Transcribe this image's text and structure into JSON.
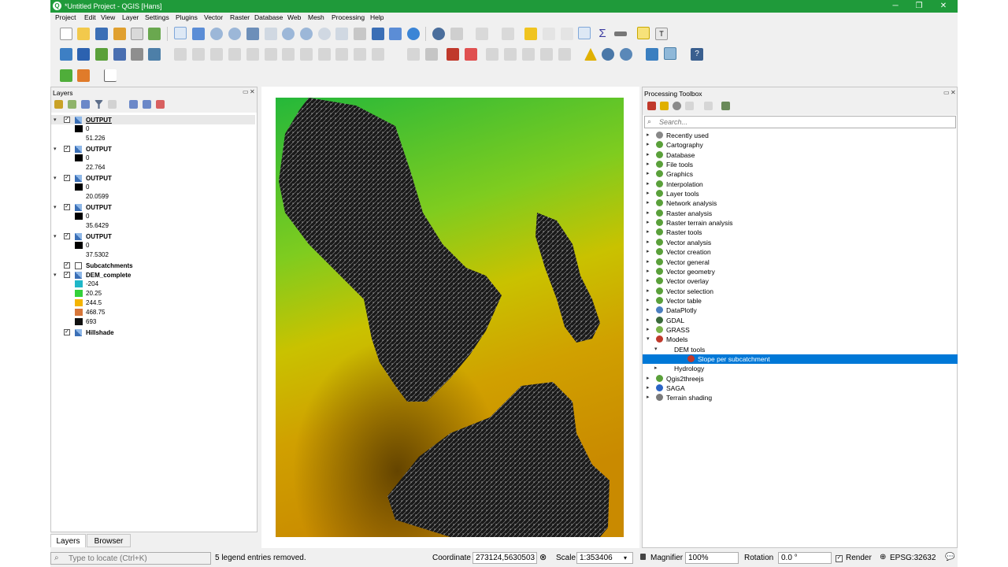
{
  "window": {
    "title": "*Untitled Project - QGIS [Hans]",
    "logo_text": "Q",
    "controls": [
      "─",
      "❐",
      "✕"
    ]
  },
  "menu": [
    "Project",
    "Edit",
    "View",
    "Layer",
    "Settings",
    "Plugins",
    "Vector",
    "Raster",
    "Database",
    "Web",
    "Mesh",
    "Processing",
    "Help"
  ],
  "layers_panel": {
    "title": "Layers",
    "layers": [
      {
        "name": "OUTPUT",
        "checked": true,
        "active": true,
        "legend": [
          {
            "label": "0",
            "color": "#000000"
          }
        ],
        "max_label": "51.226"
      },
      {
        "name": "OUTPUT",
        "checked": true,
        "legend": [
          {
            "label": "0",
            "color": "#000000"
          }
        ],
        "max_label": "22.764"
      },
      {
        "name": "OUTPUT",
        "checked": true,
        "legend": [
          {
            "label": "0",
            "color": "#000000"
          }
        ],
        "max_label": "20.0599"
      },
      {
        "name": "OUTPUT",
        "checked": true,
        "legend": [
          {
            "label": "0",
            "color": "#000000"
          }
        ],
        "max_label": "35.6429"
      },
      {
        "name": "OUTPUT",
        "checked": true,
        "legend": [
          {
            "label": "0",
            "color": "#000000"
          }
        ],
        "max_label": "37.5302"
      }
    ],
    "subcatchments": {
      "name": "Subcatchments",
      "checked": true
    },
    "dem": {
      "name": "DEM_complete",
      "checked": true,
      "legend": [
        {
          "label": "-204",
          "color": "#1fb7c8"
        },
        {
          "label": "20.25",
          "color": "#34d13a"
        },
        {
          "label": "244.5",
          "color": "#f4b400"
        },
        {
          "label": "468.75",
          "color": "#d7773a"
        },
        {
          "label": "693",
          "color": "#111111"
        }
      ]
    },
    "hillshade": {
      "name": "Hillshade",
      "checked": true
    }
  },
  "toolbox": {
    "title": "Processing Toolbox",
    "search_placeholder": "Search...",
    "items": [
      {
        "label": "Recently used",
        "icon": "clock-icon",
        "color": "#888888"
      },
      {
        "label": "Cartography",
        "icon": "qgis-icon",
        "color": "#5aa03a"
      },
      {
        "label": "Database",
        "icon": "qgis-icon",
        "color": "#5aa03a"
      },
      {
        "label": "File tools",
        "icon": "qgis-icon",
        "color": "#5aa03a"
      },
      {
        "label": "Graphics",
        "icon": "qgis-icon",
        "color": "#5aa03a"
      },
      {
        "label": "Interpolation",
        "icon": "qgis-icon",
        "color": "#5aa03a"
      },
      {
        "label": "Layer tools",
        "icon": "qgis-icon",
        "color": "#5aa03a"
      },
      {
        "label": "Network analysis",
        "icon": "qgis-icon",
        "color": "#5aa03a"
      },
      {
        "label": "Raster analysis",
        "icon": "qgis-icon",
        "color": "#5aa03a"
      },
      {
        "label": "Raster terrain analysis",
        "icon": "qgis-icon",
        "color": "#5aa03a"
      },
      {
        "label": "Raster tools",
        "icon": "qgis-icon",
        "color": "#5aa03a"
      },
      {
        "label": "Vector analysis",
        "icon": "qgis-icon",
        "color": "#5aa03a"
      },
      {
        "label": "Vector creation",
        "icon": "qgis-icon",
        "color": "#5aa03a"
      },
      {
        "label": "Vector general",
        "icon": "qgis-icon",
        "color": "#5aa03a"
      },
      {
        "label": "Vector geometry",
        "icon": "qgis-icon",
        "color": "#5aa03a"
      },
      {
        "label": "Vector overlay",
        "icon": "qgis-icon",
        "color": "#5aa03a"
      },
      {
        "label": "Vector selection",
        "icon": "qgis-icon",
        "color": "#5aa03a"
      },
      {
        "label": "Vector table",
        "icon": "qgis-icon",
        "color": "#5aa03a"
      },
      {
        "label": "DataPlotly",
        "icon": "plot-icon",
        "color": "#4a7fc0"
      },
      {
        "label": "GDAL",
        "icon": "gdal-icon",
        "color": "#3a6a3a"
      },
      {
        "label": "GRASS",
        "icon": "grass-icon",
        "color": "#7ab34a"
      },
      {
        "label": "Models",
        "icon": "models-icon",
        "color": "#c0392b"
      }
    ],
    "models_children": {
      "group": "DEM tools",
      "selected": "Slope per subcatchment"
    },
    "after_items": [
      {
        "label": "Hydrology",
        "icon": "none",
        "color": "#ffffff"
      },
      {
        "label": "Qgis2threejs",
        "icon": "qgis-icon",
        "color": "#5aa03a"
      },
      {
        "label": "SAGA",
        "icon": "saga-icon",
        "color": "#2a64c5"
      },
      {
        "label": "Terrain shading",
        "icon": "terrain-icon",
        "color": "#7a7a7a"
      }
    ]
  },
  "tabs": [
    "Layers",
    "Browser"
  ],
  "status": {
    "locate_placeholder": "Type to locate (Ctrl+K)",
    "message": "5 legend entries removed.",
    "coordinate_label": "Coordinate",
    "coordinate": "273124,5630503",
    "scale_label": "Scale",
    "scale": "1:353406",
    "magnifier_label": "Magnifier",
    "magnifier": "100%",
    "rotation_label": "Rotation",
    "rotation": "0.0 °",
    "render_label": "Render",
    "crs": "EPSG:32632"
  }
}
